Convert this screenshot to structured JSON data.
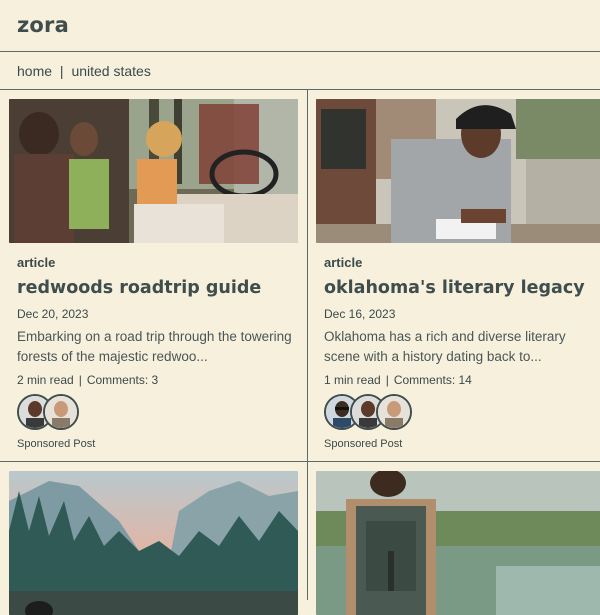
{
  "brand": {
    "logo": "zora"
  },
  "breadcrumb": {
    "home": "home",
    "separator": "|",
    "current": "united states"
  },
  "colors": {
    "background": "#f7f0dd",
    "text": "#3c4a4a",
    "divider": "#5c6a6a"
  },
  "cards": [
    {
      "image": "friends-in-jeep-photo",
      "kind": "article",
      "title": "redwoods roadtrip guide",
      "date": "Dec 20, 2023",
      "excerpt": "Embarking on a road trip through the towering forests of the majestic redwoo...",
      "read_time": "2 min read",
      "comments": "Comments: 3",
      "avatar_count": 2,
      "sponsor": "Sponsored Post"
    },
    {
      "image": "man-writing-notebook-photo",
      "kind": "article",
      "title": "oklahoma's literary legacy",
      "date": "Dec 16, 2023",
      "excerpt": "Oklahoma has a rich and diverse literary scene with a history dating back to...",
      "read_time": "1 min read",
      "comments": "Comments: 14",
      "avatar_count": 3,
      "sponsor": "Sponsored Post"
    },
    {
      "image": "mountain-valley-lake-photo"
    },
    {
      "image": "hiker-with-backpack-photo"
    }
  ]
}
